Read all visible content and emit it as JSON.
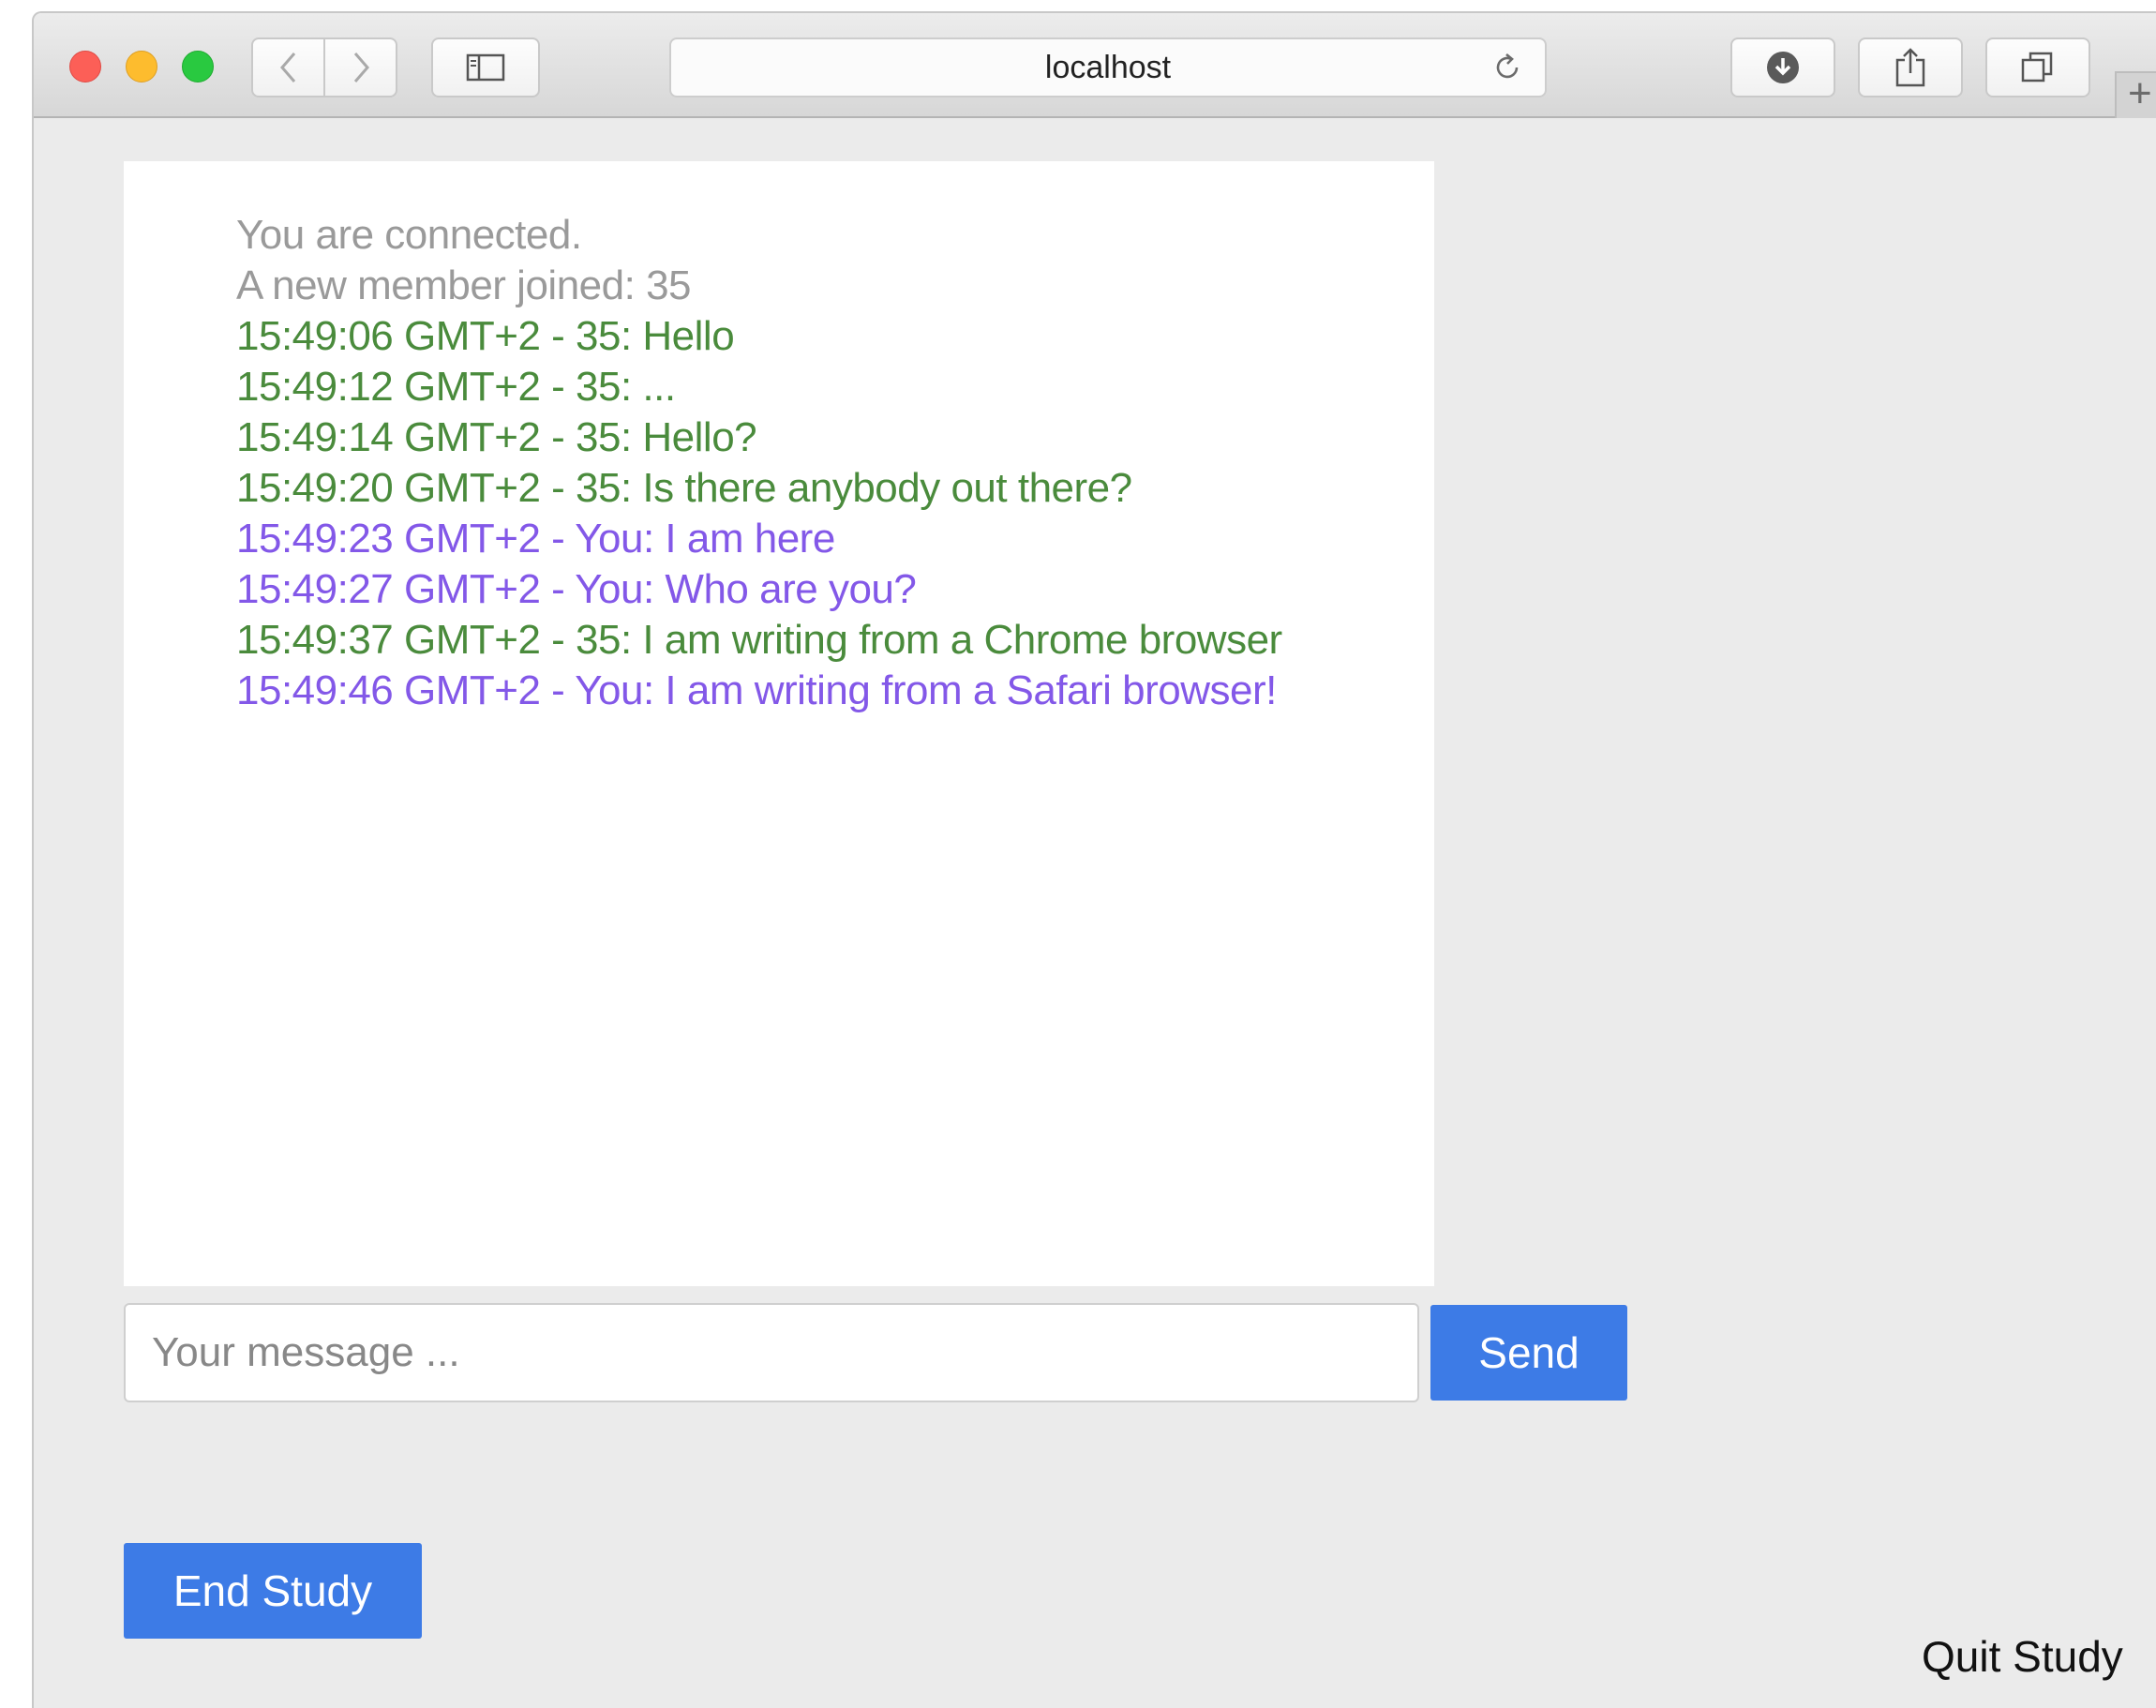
{
  "browser": {
    "address": "localhost",
    "new_tab_glyph": "+",
    "icons": {
      "back": "chevron-left-icon",
      "forward": "chevron-right-icon",
      "sidebar": "sidebar-icon",
      "reload": "reload-icon",
      "downloads": "download-icon",
      "share": "share-icon",
      "tabs": "tab-overview-icon"
    }
  },
  "colors": {
    "system": "#9a9a9a",
    "other": "#4a8b3c",
    "self": "#8358e8",
    "button": "#3d7be6"
  },
  "chat": {
    "messages": [
      {
        "type": "system",
        "text": "You are connected."
      },
      {
        "type": "system",
        "text": "A new member joined: 35"
      },
      {
        "type": "other",
        "text": "15:49:06 GMT+2 - 35: Hello"
      },
      {
        "type": "other",
        "text": "15:49:12 GMT+2 - 35: ..."
      },
      {
        "type": "other",
        "text": "15:49:14 GMT+2 - 35: Hello?"
      },
      {
        "type": "other",
        "text": "15:49:20 GMT+2 - 35: Is there anybody out there?"
      },
      {
        "type": "self",
        "text": "15:49:23 GMT+2 - You: I am here"
      },
      {
        "type": "self",
        "text": "15:49:27 GMT+2 - You: Who are you?"
      },
      {
        "type": "other",
        "text": "15:49:37 GMT+2 - 35: I am writing from a Chrome browser"
      },
      {
        "type": "self",
        "text": "15:49:46 GMT+2 - You: I am writing from a Safari browser!"
      }
    ]
  },
  "composer": {
    "placeholder": "Your message ...",
    "value": "",
    "send_label": "Send"
  },
  "footer": {
    "end_label": "End Study",
    "quit_label": "Quit Study"
  }
}
